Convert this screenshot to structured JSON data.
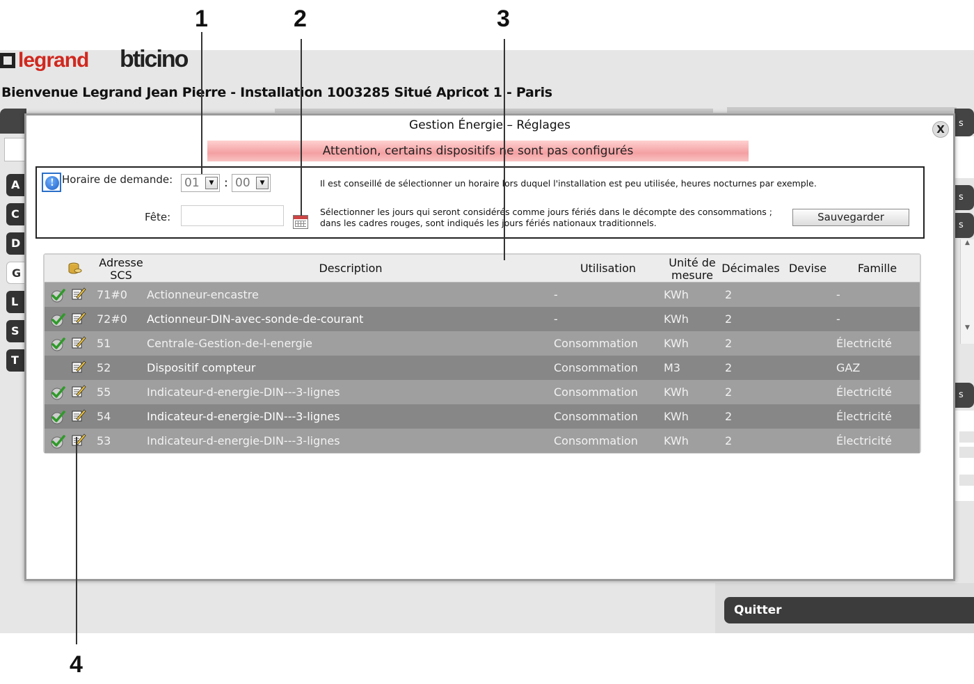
{
  "callouts": [
    "1",
    "2",
    "3",
    "4"
  ],
  "header": {
    "brand1": "legrand",
    "brand2": "bticino",
    "welcome": "Bienvenue Legrand Jean Pierre - Installation 1003285 Situé Apricot 1 - Paris"
  },
  "sidebar": {
    "items": [
      {
        "label": "A"
      },
      {
        "label": "C"
      },
      {
        "label": "D"
      },
      {
        "label": "G"
      },
      {
        "label": "L"
      },
      {
        "label": "S"
      },
      {
        "label": "T"
      }
    ]
  },
  "right_tabs": [
    "s",
    "s",
    "s",
    "s"
  ],
  "modal": {
    "title": "Gestion Énergie – Réglages",
    "close_label": "X",
    "warning": "Attention, certains dispositifs ne sont pas configurés",
    "horaire_label": "Horaire de demande:",
    "hour_value": "01",
    "minute_value": "00",
    "colon": ":",
    "hint_horaire": "Il est conseillé de sélectionner un horaire lors duquel l'installation est peu utilisée, heures nocturnes par exemple.",
    "fete_label": "Fête:",
    "fete_value": "",
    "hint_fete_line1": "Sélectionner les jours qui seront considérés comme jours fériés dans le décompte des consommations ;",
    "hint_fete_line2": "dans les cadres rouges, sont indiqués les jours fériés nationaux traditionnels.",
    "save_label": "Sauvegarder"
  },
  "table": {
    "headers": {
      "addr_line1": "Adresse",
      "addr_line2": "SCS",
      "desc": "Description",
      "util": "Utilisation",
      "unit_line1": "Unité de",
      "unit_line2": "mesure",
      "dec": "Décimales",
      "devise": "Devise",
      "famille": "Famille"
    },
    "rows": [
      {
        "addr": "71#0",
        "desc": "Actionneur-encastre",
        "util": "-",
        "unit": "KWh",
        "dec": "2",
        "devise": "",
        "famille": "-",
        "configured": true
      },
      {
        "addr": "72#0",
        "desc": "Actionneur-DIN-avec-sonde-de-courant",
        "util": "-",
        "unit": "KWh",
        "dec": "2",
        "devise": "",
        "famille": "-",
        "configured": true
      },
      {
        "addr": "51",
        "desc": "Centrale-Gestion-de-l-energie",
        "util": "Consommation",
        "unit": "KWh",
        "dec": "2",
        "devise": "",
        "famille": "Électricité",
        "configured": true
      },
      {
        "addr": "52",
        "desc": "Dispositif compteur",
        "util": "Consommation",
        "unit": "M3",
        "dec": "2",
        "devise": "",
        "famille": "GAZ",
        "configured": false
      },
      {
        "addr": "55",
        "desc": "Indicateur-d-energie-DIN---3-lignes",
        "util": "Consommation",
        "unit": "KWh",
        "dec": "2",
        "devise": "",
        "famille": "Électricité",
        "configured": true
      },
      {
        "addr": "54",
        "desc": "Indicateur-d-energie-DIN---3-lignes",
        "util": "Consommation",
        "unit": "KWh",
        "dec": "2",
        "devise": "",
        "famille": "Électricité",
        "configured": true
      },
      {
        "addr": "53",
        "desc": "Indicateur-d-energie-DIN---3-lignes",
        "util": "Consommation",
        "unit": "KWh",
        "dec": "2",
        "devise": "",
        "famille": "Électricité",
        "configured": true
      }
    ]
  },
  "footer": {
    "quit_label": "Quitter"
  },
  "colors": {
    "brand_red": "#d0281f",
    "warning_pink": "#f4a0a2",
    "row_light": "#9f9f9f",
    "row_dark": "#878787",
    "button_dark": "#3c3c3c",
    "info_blue": "#1c5fc4"
  },
  "icons": {
    "configured": "check-icon",
    "edit": "edit-icon",
    "database": "database-icon",
    "info": "info-icon",
    "calendar": "calendar-icon"
  }
}
